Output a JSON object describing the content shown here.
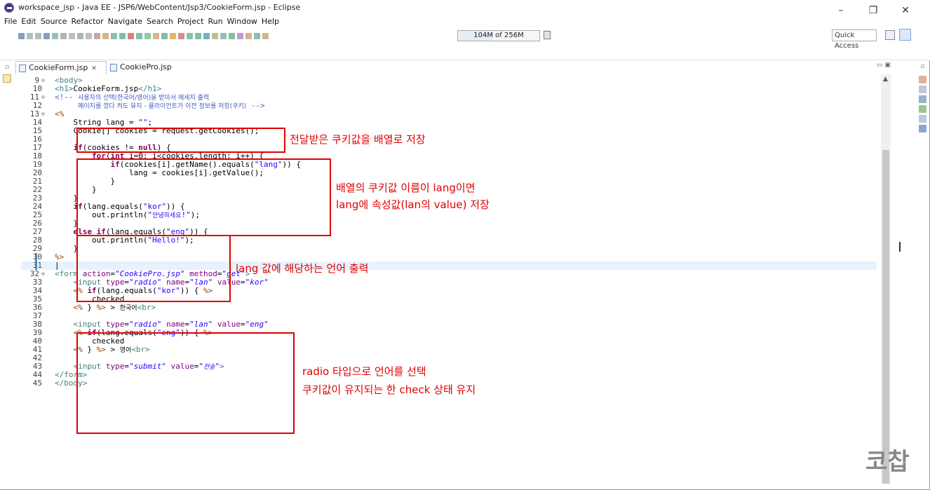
{
  "window": {
    "title": "workspace_jsp - Java EE - JSP6/WebContent/Jsp3/CookieForm.jsp - Eclipse",
    "minimize": "–",
    "maximize": "❐",
    "close": "✕"
  },
  "menu": [
    "File",
    "Edit",
    "Source",
    "Refactor",
    "Navigate",
    "Search",
    "Project",
    "Run",
    "Window",
    "Help"
  ],
  "toolbar": {
    "heap_text": "104M of 256M",
    "heap_used_fraction": 0.41,
    "quick_access": "Quick Access"
  },
  "tabs": [
    {
      "label": "CookieForm.jsp",
      "close": "✕",
      "active": true
    },
    {
      "label": "CookiePro.jsp",
      "active": false
    }
  ],
  "code_lines": [
    {
      "n": "9",
      "fold": "⊖",
      "html": "<span class=\"tg\">&lt;body&gt;</span>"
    },
    {
      "n": "10",
      "html": "<span class=\"tg\">&lt;h1&gt;</span>CookieForm.jsp<span class=\"tg\">&lt;/h1&gt;</span>"
    },
    {
      "n": "11",
      "fold": "⊖",
      "html": "<span class=\"cm\">&lt;!-- <span class=\"kr\">사용자의 선택(한국어/영어)을 받아서 메세지 출력</span></span>"
    },
    {
      "n": "12",
      "html": "<span class=\"cm\">     <span class=\"kr\">페이지를 껐다 켜도 유지 - 클라이언트가 이전 정보를 저장(쿠키)</span> --&gt;</span>"
    },
    {
      "n": "13",
      "fold": "⊖",
      "html": "<span class=\"js\">&lt;%</span>"
    },
    {
      "n": "14",
      "html": "    String lang = <span class=\"sv\">\"\"</span>;"
    },
    {
      "n": "15",
      "html": "    Cookie[] cookies = request.getCookies();"
    },
    {
      "n": "16",
      "html": ""
    },
    {
      "n": "17",
      "html": "    <span class=\"kw\">if</span>(cookies != <span class=\"kw\">null</span>) {"
    },
    {
      "n": "18",
      "html": "        <span class=\"kw\">for</span>(<span class=\"kw\">int</span> i=0; i&lt;cookies.length; i++) {"
    },
    {
      "n": "19",
      "html": "            <span class=\"kw\">if</span>(cookies[i].getName().equals(<span class=\"sv\">\"lang\"</span>)) {"
    },
    {
      "n": "20",
      "html": "                lang = cookies[i].getValue();"
    },
    {
      "n": "21",
      "html": "            }"
    },
    {
      "n": "22",
      "html": "        }"
    },
    {
      "n": "23",
      "html": "    }"
    },
    {
      "n": "24",
      "html": "    <span class=\"kw\">if</span>(lang.equals(<span class=\"sv\">\"kor\"</span>)) {"
    },
    {
      "n": "25",
      "html": "        out.println(<span class=\"sv\">\"<span class=\"kr\">안녕하세요</span>!\"</span>);"
    },
    {
      "n": "26",
      "html": "    }"
    },
    {
      "n": "27",
      "html": "    <span class=\"kw\">else if</span>(lang.equals(<span class=\"sv\">\"eng\"</span>)) {"
    },
    {
      "n": "28",
      "html": "        out.println(<span class=\"sv\">\"Hello!\"</span>);"
    },
    {
      "n": "29",
      "html": "    }"
    },
    {
      "n": "30",
      "html": "<span class=\"js\">%&gt;</span>"
    },
    {
      "n": "31",
      "html": "|"
    },
    {
      "n": "32",
      "fold": "⊖",
      "html": "<span class=\"tg\">&lt;form</span> <span class=\"at\">action</span>=<span class=\"svi\">\"CookiePro.jsp\"</span> <span class=\"at\">method</span>=<span class=\"svi\">\"get\"</span><span class=\"tg\">&gt;</span>"
    },
    {
      "n": "33",
      "html": "    <span class=\"tg\">&lt;input</span> <span class=\"at\">type</span>=<span class=\"svi\">\"radio\"</span> <span class=\"at\">name</span>=<span class=\"svi\">\"lan\"</span> <span class=\"at\">value</span>=<span class=\"svi\">\"kor\"</span>"
    },
    {
      "n": "34",
      "html": "    <span class=\"js\">&lt;%</span> <span class=\"kw\">if</span>(lang.equals(<span class=\"sv\">\"kor\"</span>)) { <span class=\"js\">%&gt;</span>"
    },
    {
      "n": "35",
      "html": "        checked"
    },
    {
      "n": "36",
      "html": "    <span class=\"js\">&lt;%</span> } <span class=\"js\">%&gt;</span> &gt; <span class=\"kr\">한국어</span><span class=\"tg\">&lt;br&gt;</span>"
    },
    {
      "n": "37",
      "html": ""
    },
    {
      "n": "38",
      "html": "    <span class=\"tg\">&lt;input</span> <span class=\"at\">type</span>=<span class=\"svi\">\"radio\"</span> <span class=\"at\">name</span>=<span class=\"svi\">\"lan\"</span> <span class=\"at\">value</span>=<span class=\"svi\">\"eng\"</span>"
    },
    {
      "n": "39",
      "html": "    <span class=\"js\">&lt;%</span> <span class=\"kw\">if</span>(lang.equals(<span class=\"sv\">\"eng\"</span>)) { <span class=\"js\">%&gt;</span>"
    },
    {
      "n": "40",
      "html": "        checked"
    },
    {
      "n": "41",
      "html": "    <span class=\"js\">&lt;%</span> } <span class=\"js\">%&gt;</span> &gt; <span class=\"kr\">영어</span><span class=\"tg\">&lt;br&gt;</span>"
    },
    {
      "n": "42",
      "html": ""
    },
    {
      "n": "43",
      "html": "    <span class=\"tg\">&lt;input</span> <span class=\"at\">type</span>=<span class=\"svi\">\"submit\"</span> <span class=\"at\">value</span>=<span class=\"svi\">\"<span class=\"kr\">전송</span>\"</span><span class=\"tg\">&gt;</span>"
    },
    {
      "n": "44",
      "html": "<span class=\"tg\">&lt;/form&gt;</span>"
    },
    {
      "n": "45",
      "html": "<span class=\"tg\">&lt;/body&gt;</span>"
    }
  ],
  "annotations": {
    "a1": "전달받은 쿠키값을 배열로 저장",
    "a2_line1": "배열의 쿠키값 이름이 lang이면",
    "a2_line2": "lang에 속성값(lan의 value) 저장",
    "a3": "lang 값에 해당하는 언어 출력",
    "a4_line1": "radio 타입으로 언어를 선택",
    "a4_line2": "쿠키값이 유지되는 한 check 상태 유지"
  },
  "watermark": "코찹"
}
